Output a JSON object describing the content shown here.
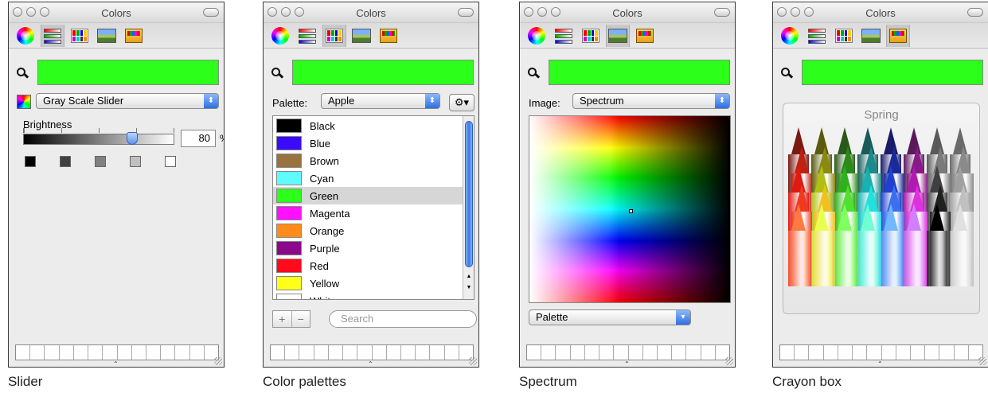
{
  "panels": [
    {
      "id": "slider",
      "window_title": "Colors",
      "caption": "Slider",
      "selected_tool": 0
    },
    {
      "id": "palettes",
      "window_title": "Colors",
      "caption": "Color palettes",
      "selected_tool": 1
    },
    {
      "id": "spectrum",
      "window_title": "Colors",
      "caption": "Spectrum",
      "selected_tool": 3
    },
    {
      "id": "crayons",
      "window_title": "Colors",
      "caption": "Crayon box",
      "selected_tool": 4
    }
  ],
  "toolbar_icons": [
    "color-wheel-icon",
    "color-sliders-icon",
    "color-palettes-icon",
    "image-palettes-icon",
    "crayons-icon"
  ],
  "current_color": "#2cff1a",
  "slider": {
    "mode_popup": "Gray Scale Slider",
    "label": "Brightness",
    "value": "80",
    "unit": "%",
    "level": 0.8,
    "presets": [
      "#000000",
      "#404040",
      "#808080",
      "#c0c0c0",
      "#ffffff"
    ]
  },
  "palettes": {
    "label": "Palette:",
    "selected_palette": "Apple",
    "gear_label": "⚙▾",
    "colors": [
      {
        "name": "Black",
        "hex": "#000000"
      },
      {
        "name": "Blue",
        "hex": "#3b0bff"
      },
      {
        "name": "Brown",
        "hex": "#9a7240"
      },
      {
        "name": "Cyan",
        "hex": "#5ffcff"
      },
      {
        "name": "Green",
        "hex": "#2cff1a"
      },
      {
        "name": "Magenta",
        "hex": "#ff11ff"
      },
      {
        "name": "Orange",
        "hex": "#ff8c1a"
      },
      {
        "name": "Purple",
        "hex": "#8a0a8a"
      },
      {
        "name": "Red",
        "hex": "#ff0a1a"
      },
      {
        "name": "Yellow",
        "hex": "#ffff1a"
      },
      {
        "name": "White",
        "hex": "#ffffff"
      }
    ],
    "selected_color": "Green",
    "add_label": "+",
    "remove_label": "−",
    "search_placeholder": "Search"
  },
  "spectrum": {
    "label": "Image:",
    "selected_image": "Spectrum",
    "bottom_popup": "Palette"
  },
  "crayons": {
    "title": "Spring",
    "rows": [
      [
        "#7a1a12",
        "#5a5a10",
        "#2a5a18",
        "#1a5a5a",
        "#1a1a6a",
        "#5a1a5a",
        "#5a5a5a",
        "#6a6a6a"
      ],
      [
        "#c02010",
        "#8a8a10",
        "#2a8a1a",
        "#1a8a8a",
        "#1a2a9a",
        "#8a1a8a",
        "#7a7a7a",
        "#8a8a8a"
      ],
      [
        "#e01a10",
        "#b0c010",
        "#30b01a",
        "#1ab0b0",
        "#2040d0",
        "#b01ab0",
        "#404040",
        "#a0a0a0"
      ],
      [
        "#f03a20",
        "#f0c020",
        "#50e030",
        "#20e0e0",
        "#3a70f0",
        "#e030e0",
        "#202020",
        "#c0c0c0"
      ],
      [
        "#ff7a40",
        "#e8ff50",
        "#80ff60",
        "#70ffd0",
        "#70b8ff",
        "#d080ff",
        "#000000",
        "#e0e0e0"
      ]
    ]
  },
  "bottom_well_slots": 14,
  "bottom_handle": "⌃"
}
